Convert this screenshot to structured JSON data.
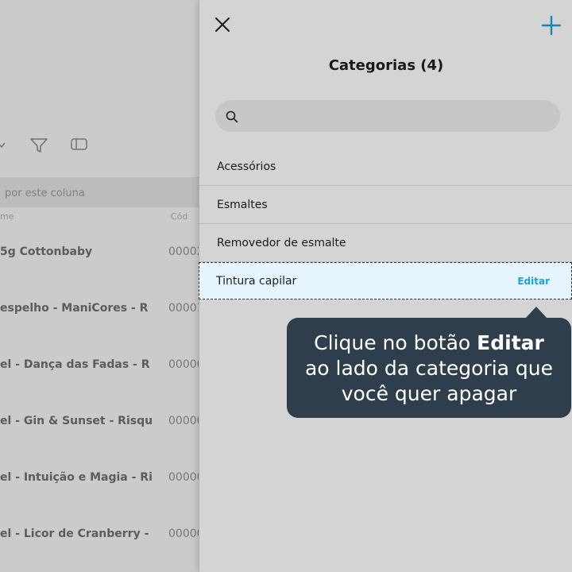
{
  "background": {
    "group_bar_text": "por este coluna",
    "column_headers": [
      "me",
      "Cód"
    ],
    "rows": [
      {
        "name": "5g Cottonbaby",
        "code": "00002"
      },
      {
        "name": "espelho - ManiCores - R",
        "code": "00001"
      },
      {
        "name": "el - Dança das Fadas - R",
        "code": "00000"
      },
      {
        "name": "el - Gin & Sunset - Risqu",
        "code": "00000"
      },
      {
        "name": "el - Intuição e Magia - Ri",
        "code": "00000"
      },
      {
        "name": "el - Licor de Cranberry -",
        "code": "00000"
      }
    ]
  },
  "panel": {
    "title": "Categorias (4)",
    "search_placeholder": "",
    "categories": [
      {
        "label": "Acessórios"
      },
      {
        "label": "Esmaltes"
      },
      {
        "label": "Removedor de esmalte"
      },
      {
        "label": "Tintura capilar",
        "action": "Editar"
      }
    ]
  },
  "tooltip": {
    "line1_prefix": "Clique no botão ",
    "line1_bold": "Editar",
    "line2": "ao lado da categoria que",
    "line3": "você quer apagar"
  },
  "colors": {
    "accent": "#1aa3d9",
    "tooltip_bg": "#2f3e4c",
    "highlight_bg": "#e6f5fd"
  },
  "icons": {
    "close": "close-icon",
    "add": "plus-icon",
    "search": "search-icon",
    "filter": "filter-icon",
    "columns": "columns-icon",
    "chevron": "chevron-down-icon"
  }
}
